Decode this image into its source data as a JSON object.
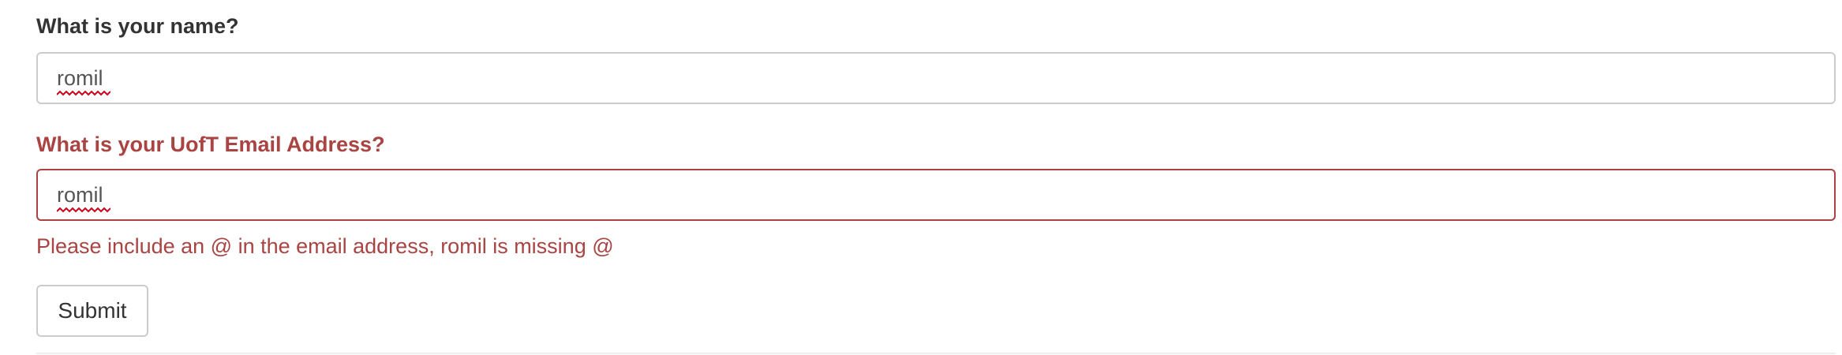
{
  "form": {
    "name_field": {
      "label": "What is your name?",
      "value": "romil"
    },
    "email_field": {
      "label": "What is your UofT Email Address?",
      "value": "romil",
      "error_message": "Please include an @ in the email address, romil is missing @"
    },
    "submit_label": "Submit"
  },
  "colors": {
    "error": "#a94442",
    "label": "#333333",
    "input_border": "#cccccc",
    "spellcheck": "#d0021b"
  }
}
